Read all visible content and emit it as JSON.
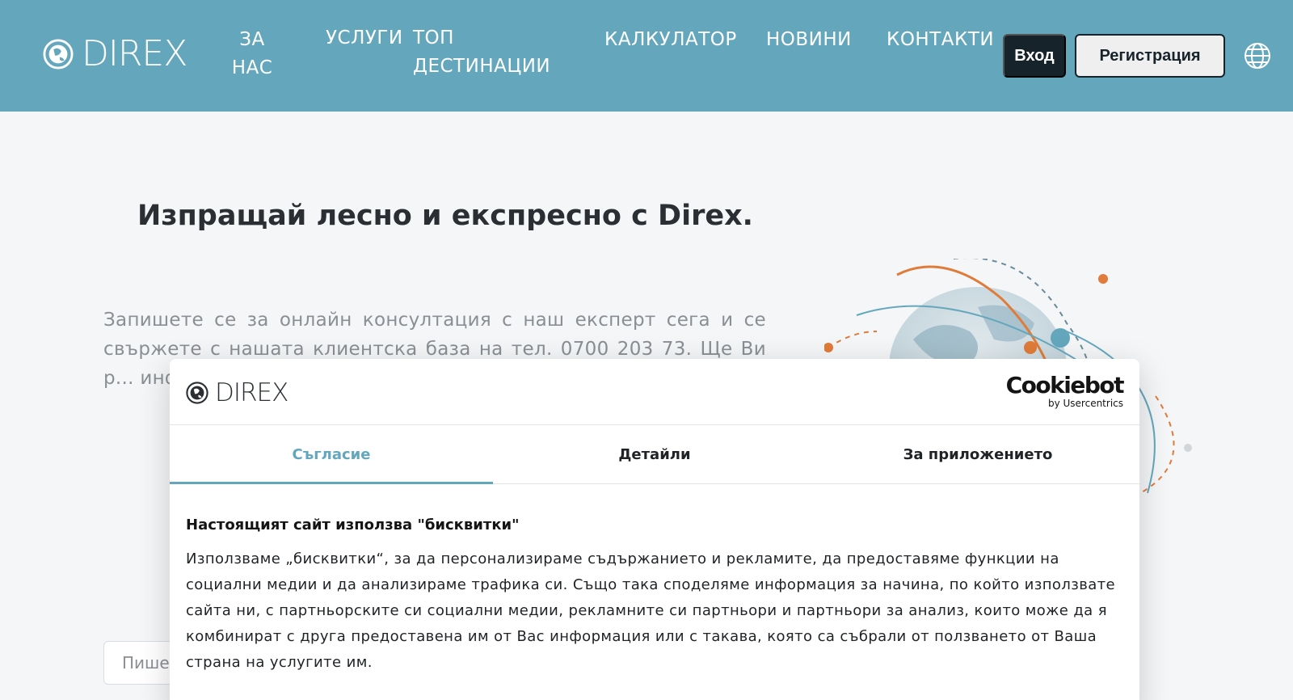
{
  "header": {
    "brand": "DIREX",
    "nav": [
      {
        "label_line1": "ЗА",
        "label_line2": "НАС"
      },
      {
        "label": "УСЛУГИ"
      },
      {
        "label_line1": "ТОП",
        "label_line2": "ДЕСТИНАЦИИ"
      },
      {
        "label": "КАЛКУЛАТОР"
      },
      {
        "label": "НОВИНИ"
      },
      {
        "label": "КОНТАКТИ"
      }
    ],
    "login_label": "Вход",
    "register_label": "Регистрация",
    "language_icon": "globe-icon"
  },
  "hero": {
    "title": "Изпращай лесно и експресно с Direx.",
    "text": "Запишете се за онлайн консултация с наш експерт сега и се свържете с нашата клиентска база на тел. 0700 203 73. Ще Ви р... инфор... изгот... на ощ... да изп... нашат...",
    "input_placeholder": "Пише"
  },
  "cookie_dialog": {
    "brand": "DIREX",
    "provider_name": "Cookiebot",
    "provider_sub": "by Usercentrics",
    "tabs": [
      {
        "label": "Съгласие",
        "active": true
      },
      {
        "label": "Детайли",
        "active": false
      },
      {
        "label": "За приложението",
        "active": false
      }
    ],
    "heading": "Настоящият сайт използва \"бисквитки\"",
    "body": "Използваме „бисквитки“, за да персонализираме съдържанието и рекламите, да предоставяме функции на социални медии и да анализираме трафика си. Също така споделяме информация за начина, по който използвате сайта ни, с партньорските си социални медии, рекламните си партньори и партньори за анализ, които може да я комбинират с друга предоставена им от Вас информация или с такава, която са събрали от ползването от Ваша страна на услугите им."
  },
  "colors": {
    "header_bg": "#64a7bd",
    "accent": "#64a7bd",
    "dark": "#17232a",
    "orange": "#e07b39"
  }
}
